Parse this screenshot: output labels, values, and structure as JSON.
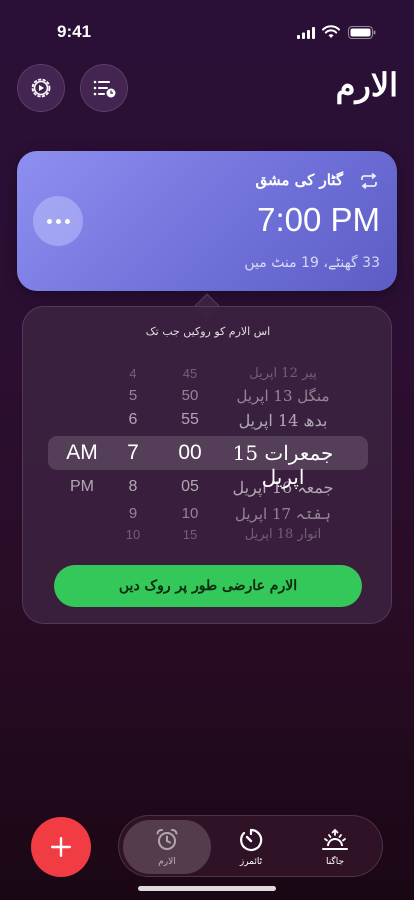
{
  "status_bar": {
    "time": "9:41"
  },
  "header": {
    "title": "الارم"
  },
  "alarm": {
    "name": "گٹار کی مشق",
    "time": "7:00 PM",
    "remaining": "33 گھنٹے، 19 منٹ میں"
  },
  "snooze_popover": {
    "title": "اس الارم کو روکیں جب تک",
    "picker_rows": [
      {
        "ampm": "",
        "hour": "4",
        "minute": "45",
        "date": "پیر 12 اپریل"
      },
      {
        "ampm": "",
        "hour": "5",
        "minute": "50",
        "date": "منگل 13 اپریل"
      },
      {
        "ampm": "",
        "hour": "6",
        "minute": "55",
        "date": "بدھ 14 اپریل"
      },
      {
        "ampm": "AM",
        "hour": "7",
        "minute": "00",
        "date": "جمعرات 15 اپریل"
      },
      {
        "ampm": "PM",
        "hour": "8",
        "minute": "05",
        "date": "جمعہ 16 اپریل"
      },
      {
        "ampm": "",
        "hour": "9",
        "minute": "10",
        "date": "ہفتہ 17 اپریل"
      },
      {
        "ampm": "",
        "hour": "10",
        "minute": "15",
        "date": "اتوار 18 اپریل"
      }
    ],
    "confirm_label": "الارم عارضی طور پر روک دیں"
  },
  "tabs": [
    {
      "label": "الارم",
      "icon": "alarm-clock-icon",
      "active": true
    },
    {
      "label": "ٹائمرز",
      "icon": "timer-icon",
      "active": false
    },
    {
      "label": "جاگنا",
      "icon": "sunrise-icon",
      "active": false
    }
  ],
  "colors": {
    "card": "#7b7ce6",
    "confirm": "#34c759",
    "add": "#f23c44"
  }
}
